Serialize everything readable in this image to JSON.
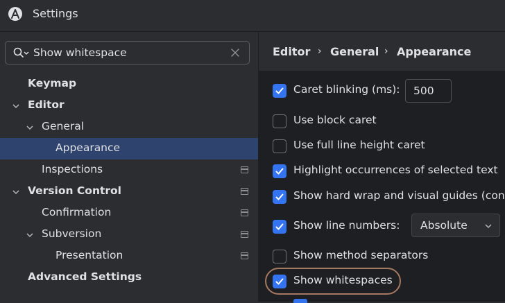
{
  "window": {
    "title": "Settings"
  },
  "search": {
    "value": "Show whitespace"
  },
  "tree": {
    "items": [
      {
        "label": "Keymap"
      },
      {
        "label": "Editor"
      },
      {
        "label": "General"
      },
      {
        "label": "Appearance"
      },
      {
        "label": "Inspections"
      },
      {
        "label": "Version Control"
      },
      {
        "label": "Confirmation"
      },
      {
        "label": "Subversion"
      },
      {
        "label": "Presentation"
      },
      {
        "label": "Advanced Settings"
      }
    ]
  },
  "breadcrumb": {
    "items": [
      "Editor",
      "General",
      "Appearance"
    ],
    "separator": "›"
  },
  "options": {
    "caret_blinking": {
      "label": "Caret blinking (ms):",
      "checked": true,
      "value": "500"
    },
    "block_caret": {
      "label": "Use block caret",
      "checked": false
    },
    "full_line_caret": {
      "label": "Use full line height caret",
      "checked": false
    },
    "highlight_occurrences": {
      "label": "Highlight occurrences of selected text",
      "checked": true
    },
    "hard_wrap": {
      "label": "Show hard wrap and visual guides (con",
      "checked": true
    },
    "line_numbers": {
      "label": "Show line numbers:",
      "checked": true,
      "value": "Absolute"
    },
    "method_separators": {
      "label": "Show method separators",
      "checked": false
    },
    "whitespaces": {
      "label": "Show whitespaces",
      "checked": true
    }
  },
  "colors": {
    "accent": "#3574f0",
    "selection": "#2e436e",
    "highlight_ring": "#a57961"
  }
}
